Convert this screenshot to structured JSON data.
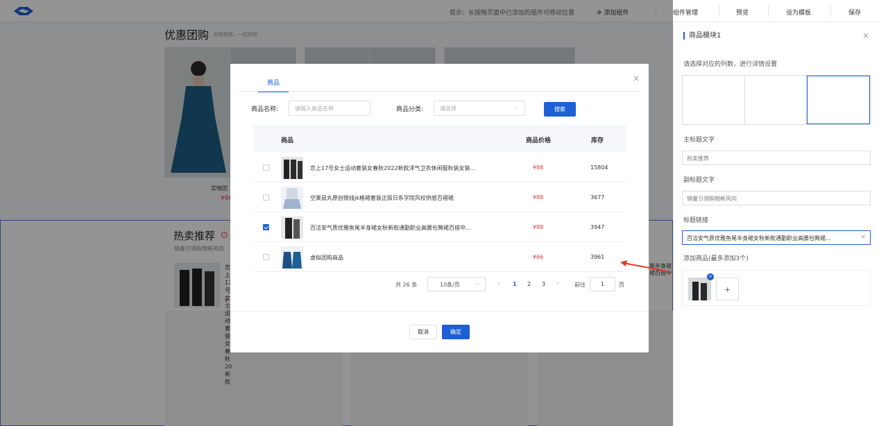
{
  "topbar": {
    "hint": "提示：长按拖页面中已添加的组件可移动位置",
    "add_component": "添加组件",
    "manage": "组件管理",
    "preview": "预览",
    "set_template": "设为模板",
    "save": "保存"
  },
  "canvas": {
    "group_title": "优惠团购",
    "group_subtitle": "好物推荐，一起拼团",
    "physical_name": "实物团",
    "physical_price": "¥66",
    "hot_title": "热卖推荐",
    "hot_subtitle": "销量引领购物新风向",
    "hot_item_text": "恋上17号女士运动套装女春秋2022新款",
    "hot_item_price": "¥",
    "side_snippet_1": "尾半身裙",
    "side_snippet_2": "裙百搭中"
  },
  "panel": {
    "title": "商品模块1",
    "col_hint": "请选择对应的列数，进行详情设置",
    "main_title_label": "主标题文字",
    "main_title_value": "热卖推荐",
    "sub_title_label": "副标题文字",
    "sub_title_value": "销量引领购物新风向",
    "link_label": "标题链接",
    "link_value": "百洁安气质优雅鱼尾半身裙女秋新款通勤职业高腰包臀裙…",
    "add_label": "添加商品(最多添加3个)",
    "plus": "+",
    "badge": "×"
  },
  "dialog": {
    "tab": "商品",
    "name_label": "商品名称:",
    "name_placeholder": "请输入商品名称",
    "category_label": "商品分类:",
    "category_placeholder": "请选择",
    "search": "搜索",
    "columns": {
      "product": "商品",
      "price": "商品价格",
      "stock": "库存"
    },
    "rows": [
      {
        "name": "恋上17号女士运动套装女春秋2022新款洋气卫衣休闲服秋装女装…",
        "price": "¥88",
        "stock": "15804",
        "checked": false
      },
      {
        "name": "空栗鼠丸原创银线jk格裙套装正版日系学院风校供感百褶裙",
        "price": "¥88",
        "stock": "3677",
        "checked": false
      },
      {
        "name": "百洁安气质优雅鱼尾半身裙女秋新款通勤职业高腰包臀裙百搭中…",
        "price": "¥88",
        "stock": "3947",
        "checked": true
      },
      {
        "name": "虚拟团购商品",
        "price": "¥66",
        "stock": "3961",
        "checked": false
      }
    ],
    "pager": {
      "total": "共 26 条",
      "size": "10条/页",
      "pages": [
        "1",
        "2",
        "3"
      ],
      "goto": "前往",
      "jump": "1",
      "page_unit": "页"
    },
    "cancel": "取消",
    "confirm": "确定"
  },
  "colors": {
    "primary": "#1e5fd6",
    "price": "#e4393c"
  }
}
